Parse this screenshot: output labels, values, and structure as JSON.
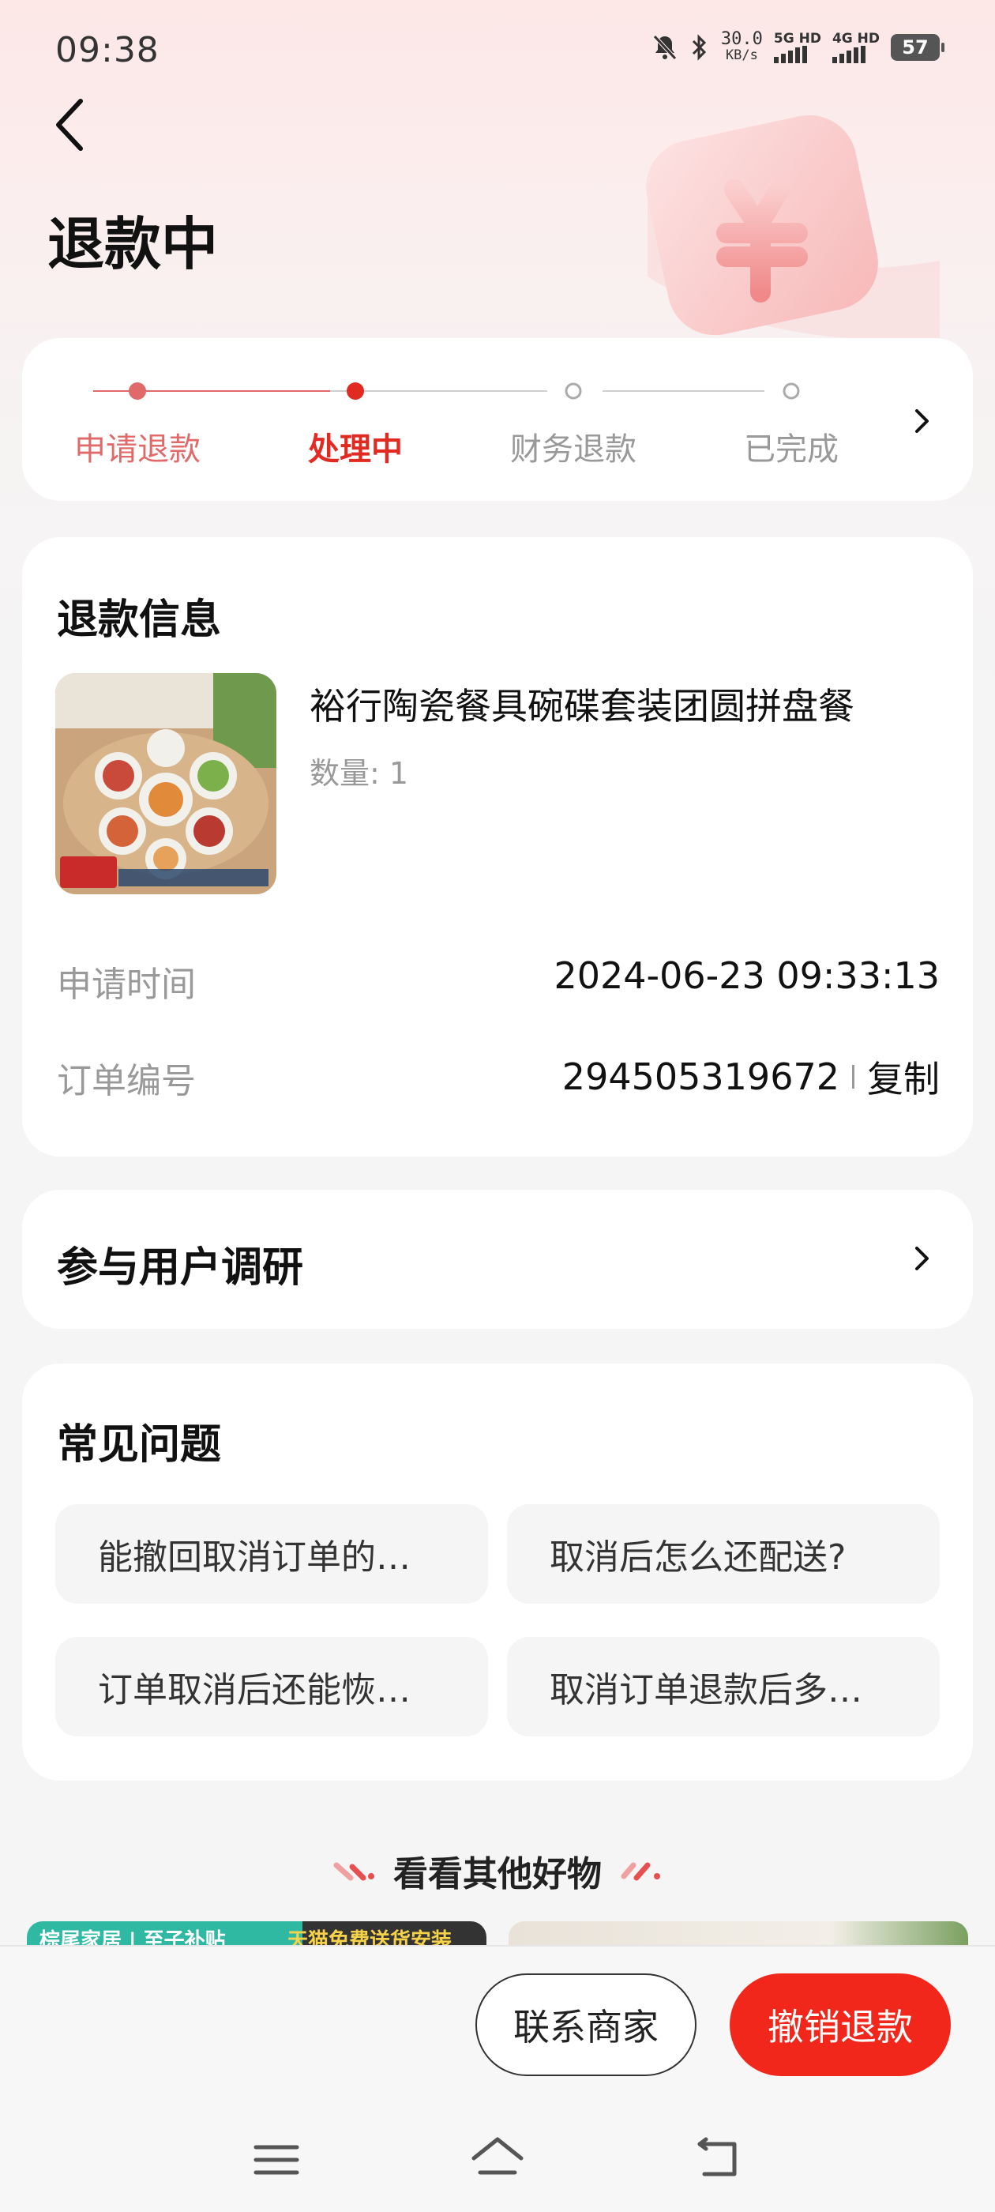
{
  "status_bar": {
    "time": "09:38",
    "net_speed": "30.0",
    "net_unit": "KB/s",
    "sim1": "5G HD",
    "sim2": "4G HD",
    "battery": "57",
    "icons": [
      "mute-icon",
      "bluetooth-icon"
    ]
  },
  "header": {
    "title": "退款中"
  },
  "progress": {
    "steps": [
      {
        "label": "申请退款",
        "state": "done"
      },
      {
        "label": "处理中",
        "state": "active"
      },
      {
        "label": "财务退款",
        "state": "pending"
      },
      {
        "label": "已完成",
        "state": "pending"
      }
    ],
    "accent_color": "#e12a22"
  },
  "refund_info": {
    "title": "退款信息",
    "product_name": "裕行陶瓷餐具碗碟套装团圆拼盘餐",
    "quantity": "数量: 1",
    "apply_time_label": "申请时间",
    "apply_time": "2024-06-23 09:33:13",
    "order_no_label": "订单编号",
    "order_no": "294505319672",
    "copy_label": "复制"
  },
  "survey": {
    "label": "参与用户调研"
  },
  "faq": {
    "title": "常见问题",
    "items": [
      "能撤回取消订单的…",
      "取消后怎么还配送?",
      "订单取消后还能恢…",
      "取消订单退款后多…"
    ]
  },
  "recommend": {
    "title": "看看其他好物",
    "left_preview_text": "棕尾家居 | 至子补贴",
    "left_preview_tag": "天猫免费送货安装"
  },
  "actions": {
    "contact_label": "联系商家",
    "cancel_label": "撤销退款",
    "cancel_color": "#f2271c"
  },
  "nav": {
    "icons": [
      "menu-icon",
      "home-icon",
      "back-icon"
    ]
  }
}
